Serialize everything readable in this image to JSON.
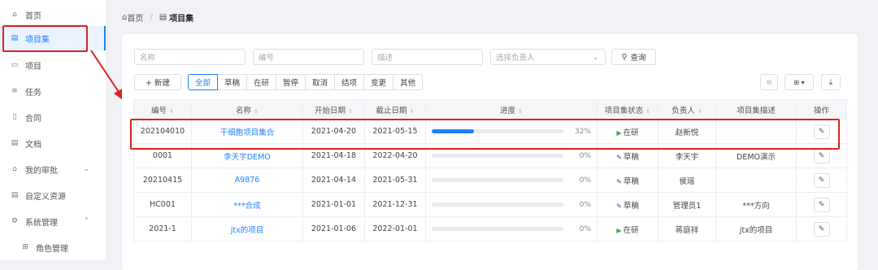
{
  "sidebar": {
    "items": [
      {
        "icon": "⌂",
        "label": "首页"
      },
      {
        "icon": "▤",
        "label": "项目集"
      },
      {
        "icon": "▭",
        "label": "项目"
      },
      {
        "icon": "≡",
        "label": "任务"
      },
      {
        "icon": "▯",
        "label": "合同"
      },
      {
        "icon": "▤",
        "label": "文档"
      },
      {
        "icon": "⌂",
        "label": "我的审批",
        "caret": "⌄"
      },
      {
        "icon": "▤",
        "label": "自定义资源"
      },
      {
        "icon": "⚙",
        "label": "系统管理",
        "caret": "⌃"
      },
      {
        "icon": "⊞",
        "label": "角色管理"
      }
    ]
  },
  "breadcrumb": {
    "home": "首页",
    "current": "项目集"
  },
  "filters": {
    "name": "名称",
    "code": "编号",
    "desc": "描述",
    "owner": "选择负责人",
    "query_btn": "查询"
  },
  "toolbar": {
    "new_btn": "+ 新建"
  },
  "tabs": [
    "全部",
    "草稿",
    "在研",
    "暂停",
    "取消",
    "结项",
    "变更",
    "其他"
  ],
  "table": {
    "headers": [
      "编号",
      "名称",
      "开始日期",
      "截止日期",
      "进度",
      "项目集状态",
      "负责人",
      "项目集描述",
      "操作"
    ],
    "rows": [
      {
        "code": "202104010",
        "name": "干细胞项目集合",
        "start": "2021-04-20",
        "end": "2021-05-15",
        "progress": 0.32,
        "progress_label": "32%",
        "status": "在研",
        "status_type": "run",
        "owner": "赵新悦",
        "desc": ""
      },
      {
        "code": "0001",
        "name": "李天宇DEMO",
        "start": "2021-04-18",
        "end": "2022-04-20",
        "progress": 0,
        "progress_label": "0%",
        "status": "草稿",
        "status_type": "draft",
        "owner": "李天宇",
        "desc": "DEMO演示"
      },
      {
        "code": "20210415",
        "name": "A9876",
        "start": "2021-04-14",
        "end": "2021-05-31",
        "progress": 0,
        "progress_label": "0%",
        "status": "草稿",
        "status_type": "draft",
        "owner": "侯瑶",
        "desc": ""
      },
      {
        "code": "HC001",
        "name": "***合成",
        "start": "2021-01-01",
        "end": "2021-12-31",
        "progress": 0,
        "progress_label": "0%",
        "status": "草稿",
        "status_type": "draft",
        "owner": "管理员1",
        "desc": "***方向"
      },
      {
        "code": "2021-1",
        "name": "jtx的项目",
        "start": "2021-01-06",
        "end": "2022-01-01",
        "progress": 0,
        "progress_label": "0%",
        "status": "在研",
        "status_type": "run",
        "owner": "蒋庭祥",
        "desc": "jtx的项目"
      }
    ]
  },
  "colors": {
    "accent": "#1e80ff",
    "highlight": "#e02020",
    "running": "#2fae4b"
  }
}
